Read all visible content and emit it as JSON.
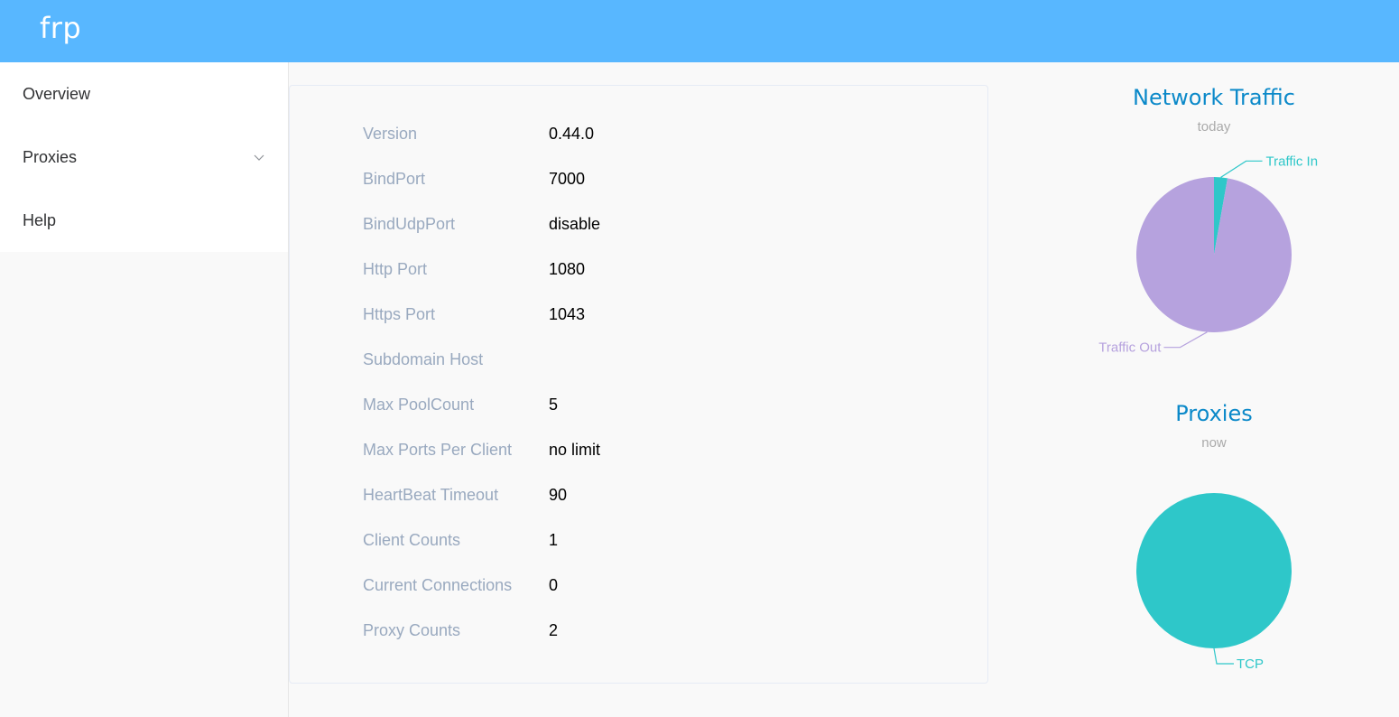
{
  "app": {
    "title": "frp"
  },
  "sidebar": {
    "items": [
      {
        "label": "Overview"
      },
      {
        "label": "Proxies",
        "has_submenu": true
      },
      {
        "label": "Help"
      }
    ]
  },
  "overview": {
    "rows": [
      {
        "key": "Version",
        "value": "0.44.0"
      },
      {
        "key": "BindPort",
        "value": "7000"
      },
      {
        "key": "BindUdpPort",
        "value": "disable"
      },
      {
        "key": "Http Port",
        "value": "1080"
      },
      {
        "key": "Https Port",
        "value": "1043"
      },
      {
        "key": "Subdomain Host",
        "value": ""
      },
      {
        "key": "Max PoolCount",
        "value": "5"
      },
      {
        "key": "Max Ports Per Client",
        "value": "no limit"
      },
      {
        "key": "HeartBeat Timeout",
        "value": "90"
      },
      {
        "key": "Client Counts",
        "value": "1"
      },
      {
        "key": "Current Connections",
        "value": "0"
      },
      {
        "key": "Proxy Counts",
        "value": "2"
      }
    ]
  },
  "chart_data": [
    {
      "type": "pie",
      "title": "Network Traffic",
      "subtitle": "today",
      "slices": [
        {
          "label": "Traffic In",
          "value": 2.8,
          "color": "#2ec7c9"
        },
        {
          "label": "Traffic Out",
          "value": 97.2,
          "color": "#b6a2de"
        }
      ]
    },
    {
      "type": "pie",
      "title": "Proxies",
      "subtitle": "now",
      "slices": [
        {
          "label": "TCP",
          "value": 100,
          "color": "#2ec7c9"
        }
      ]
    }
  ]
}
